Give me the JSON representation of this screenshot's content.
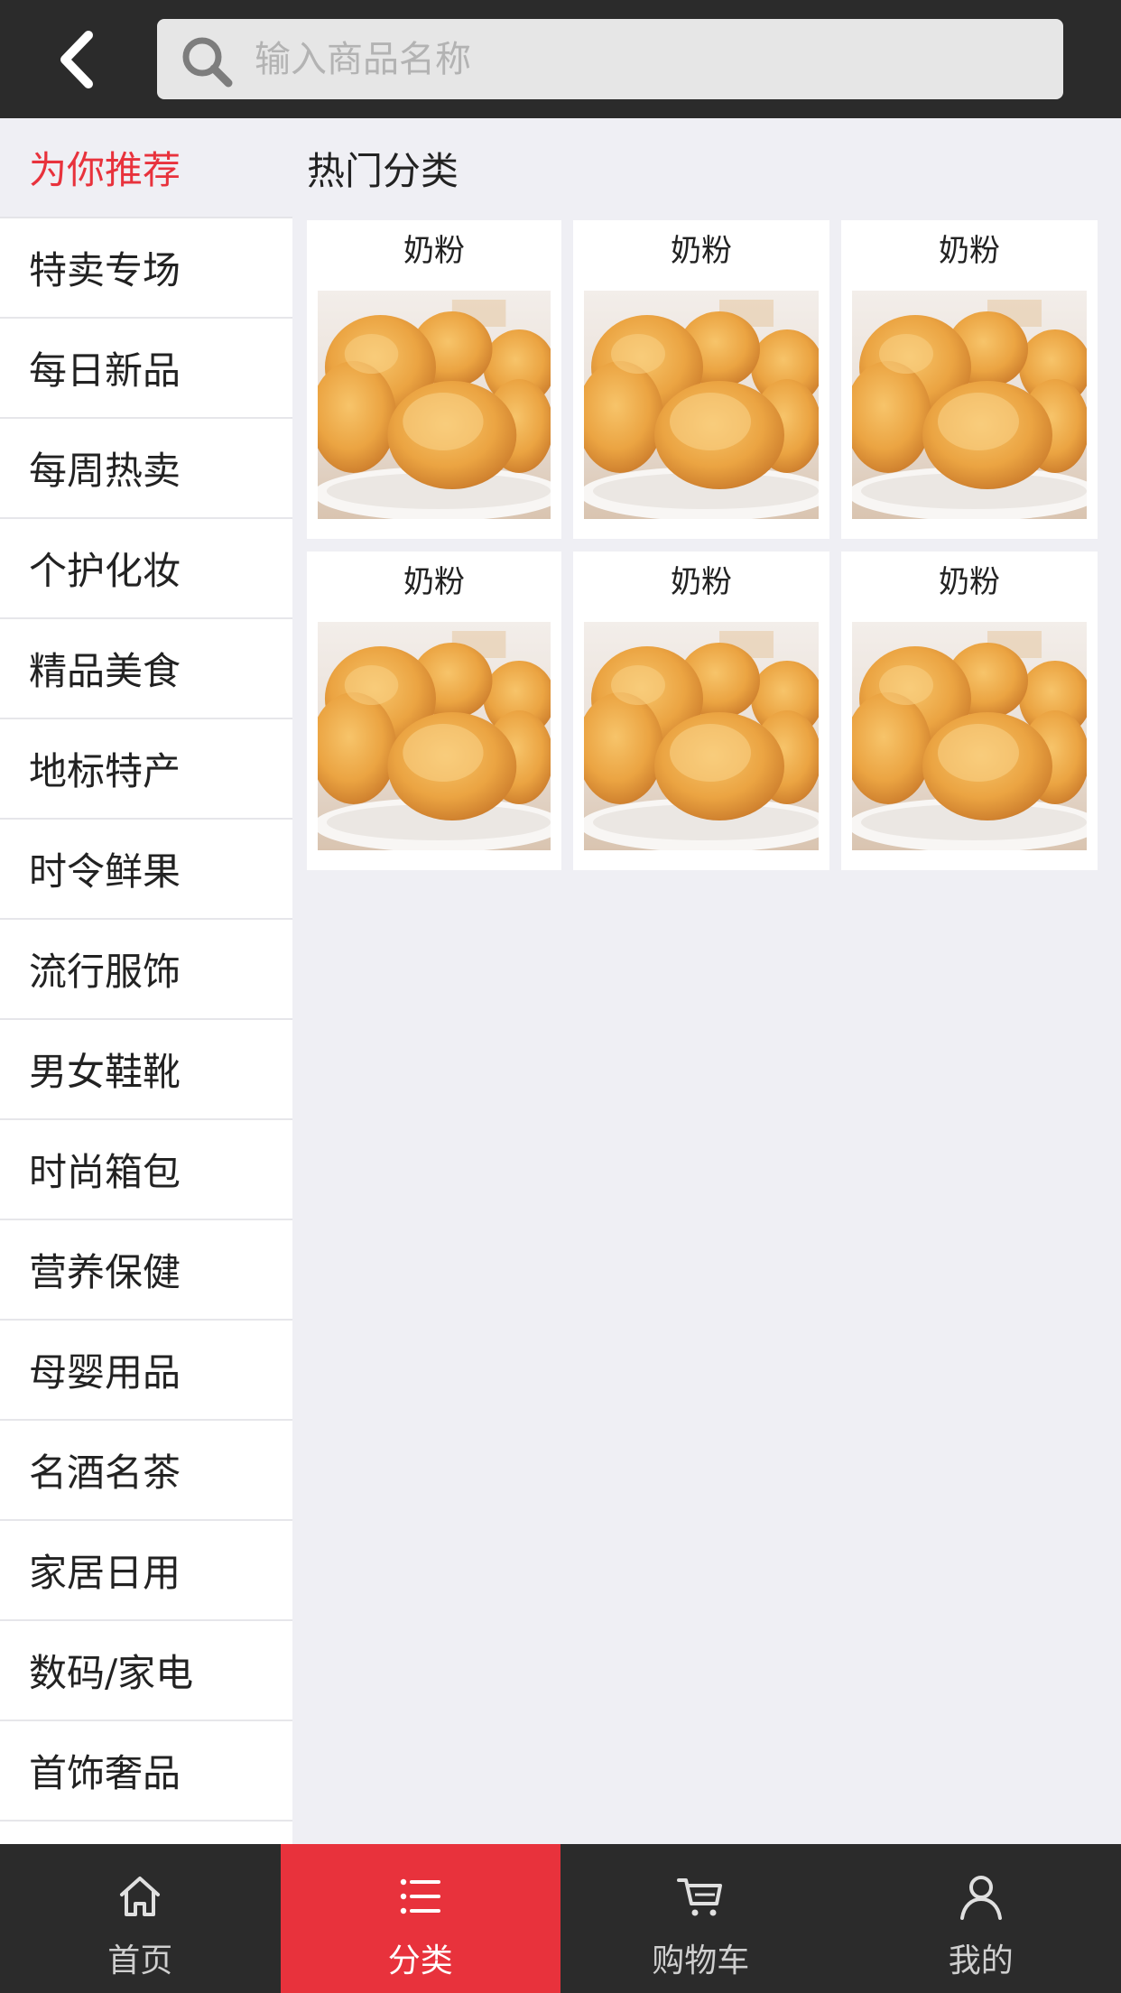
{
  "header": {
    "search_placeholder": "输入商品名称"
  },
  "sidebar": {
    "recommend_label": "为你推荐",
    "items": [
      {
        "label": "特卖专场"
      },
      {
        "label": "每日新品"
      },
      {
        "label": "每周热卖"
      },
      {
        "label": "个护化妆"
      },
      {
        "label": "精品美食"
      },
      {
        "label": "地标特产"
      },
      {
        "label": "时令鲜果"
      },
      {
        "label": "流行服饰"
      },
      {
        "label": "男女鞋靴"
      },
      {
        "label": "时尚箱包"
      },
      {
        "label": "营养保健"
      },
      {
        "label": "母婴用品"
      },
      {
        "label": "名酒名茶"
      },
      {
        "label": "家居日用"
      },
      {
        "label": "数码/家电"
      },
      {
        "label": "首饰奢品"
      }
    ]
  },
  "main": {
    "section_title": "热门分类",
    "cards": [
      {
        "label": "奶粉"
      },
      {
        "label": "奶粉"
      },
      {
        "label": "奶粉"
      },
      {
        "label": "奶粉"
      },
      {
        "label": "奶粉"
      },
      {
        "label": "奶粉"
      }
    ]
  },
  "tabbar": {
    "tabs": [
      {
        "label": "首页",
        "icon": "home-icon"
      },
      {
        "label": "分类",
        "icon": "list-icon",
        "active": true
      },
      {
        "label": "购物车",
        "icon": "cart-icon"
      },
      {
        "label": "我的",
        "icon": "user-icon"
      }
    ]
  },
  "colors": {
    "header_bg": "#2b2b2b",
    "accent": "#e8323c",
    "page_bg": "#efeff4"
  }
}
